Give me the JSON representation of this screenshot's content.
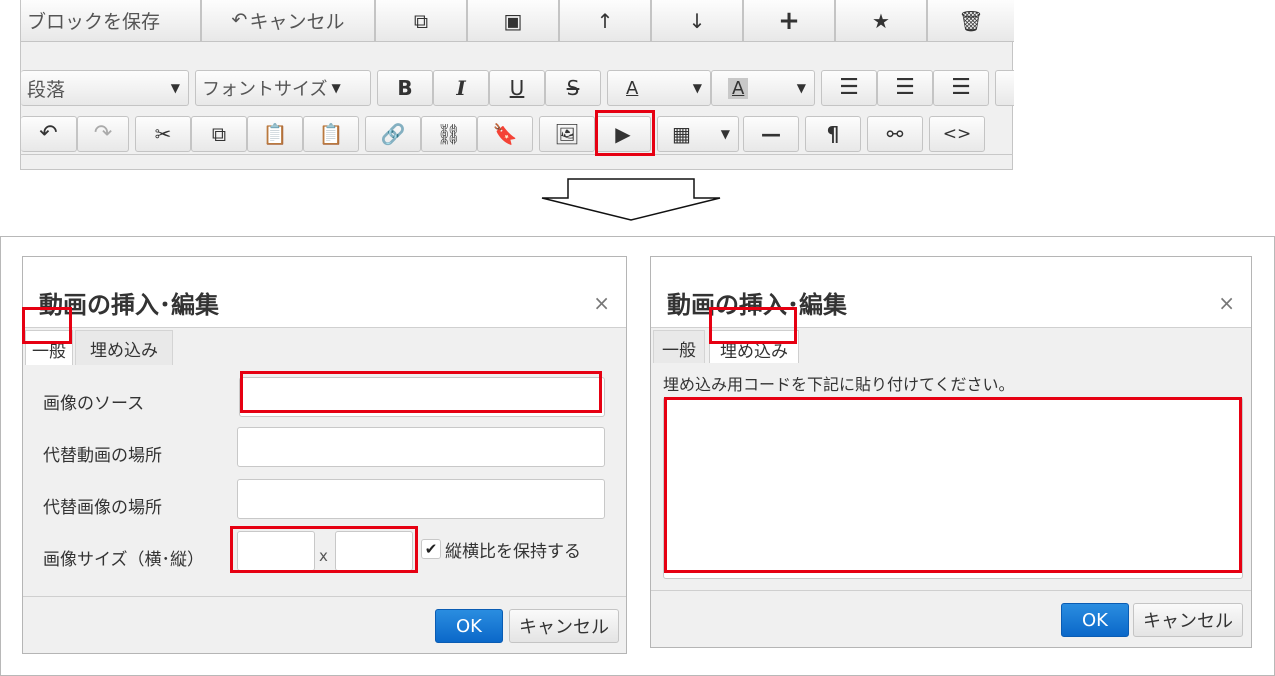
{
  "toolbar": {
    "row1": {
      "save_block": "ブロックを保存",
      "cancel": "キャンセル",
      "cancel_icon": "reply-arrow-icon",
      "icons": [
        "copy-icon",
        "archive-icon",
        "arrow-up-icon",
        "arrow-down-icon",
        "plus-icon",
        "star-icon",
        "trash-icon"
      ]
    },
    "row2": {
      "paragraph_select": "段落",
      "font_size_select": "フォントサイズ",
      "bold": "B",
      "italic": "I",
      "underline": "U",
      "strike": "S",
      "text_color": "A",
      "bg_color": "A"
    },
    "row3": {
      "icons": [
        "undo-icon",
        "redo-icon",
        "cut-icon",
        "copy-icon",
        "paste-icon",
        "paste-text-icon",
        "link-icon",
        "unlink-icon",
        "bookmark-icon",
        "image-icon",
        "media-icon",
        "table-icon",
        "horizontal-rule-icon",
        "pilcrow-icon",
        "find-replace-icon",
        "code-icon"
      ]
    }
  },
  "highlight_color": "#e60012",
  "dialog_general": {
    "title": "動画の挿入･編集",
    "close": "×",
    "tabs": [
      "一般",
      "埋め込み"
    ],
    "active_tab": "一般",
    "fields": {
      "source_label": "画像のソース",
      "alt_video_label": "代替動画の場所",
      "alt_image_label": "代替画像の場所",
      "size_label": "画像サイズ（横･縦）",
      "size_separator": "x",
      "keep_ratio_label": "縦横比を保持する",
      "keep_ratio_checked": true
    },
    "ok": "OK",
    "cancel": "キャンセル"
  },
  "dialog_embed": {
    "title": "動画の挿入･編集",
    "close": "×",
    "tabs": [
      "一般",
      "埋め込み"
    ],
    "active_tab": "埋め込み",
    "instruction": "埋め込み用コードを下記に貼り付けてください。",
    "ok": "OK",
    "cancel": "キャンセル"
  }
}
